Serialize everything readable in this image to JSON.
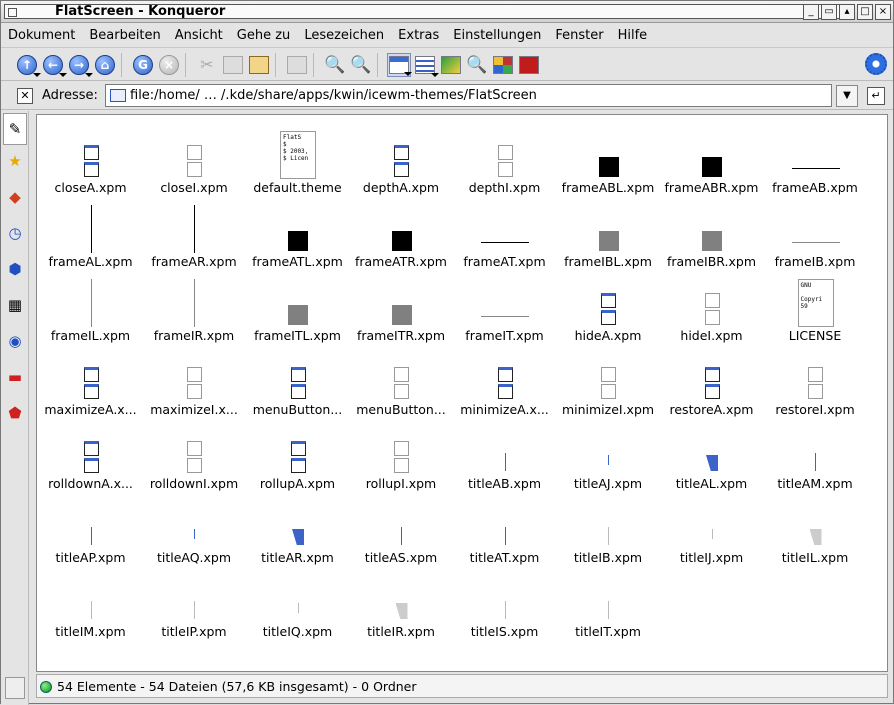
{
  "window": {
    "title": "FlatScreen - Konqueror"
  },
  "menu": [
    "Dokument",
    "Bearbeiten",
    "Ansicht",
    "Gehe zu",
    "Lesezeichen",
    "Extras",
    "Einstellungen",
    "Fenster",
    "Hilfe"
  ],
  "toolbar": {
    "icons": [
      "up-arrow-icon",
      "back-arrow-icon",
      "forward-arrow-icon",
      "home-icon",
      "reload-icon",
      "stop-icon",
      "cut-icon",
      "copy-icon",
      "paste-icon",
      "print-icon",
      "zoom-in-icon",
      "zoom-out-icon",
      "icon-view-icon",
      "detail-view-icon",
      "image-viewer-icon",
      "find-icon",
      "color-grid-icon",
      "red-grid-icon",
      "settings-gear-icon"
    ]
  },
  "address": {
    "label": "Adresse:",
    "value": "file:/home/ … /.kde/share/apps/kwin/icewm-themes/FlatScreen"
  },
  "sidebar": {
    "tabs": [
      "wizard-icon",
      "bookmark-star-icon",
      "services-icon",
      "history-icon",
      "network-icon",
      "devices-icon",
      "web-icon",
      "home-folder-icon",
      "bookmarks-red-icon"
    ]
  },
  "files": [
    {
      "name": "closeA.xpm",
      "kind": "win-blue"
    },
    {
      "name": "closeI.xpm",
      "kind": "win-gray"
    },
    {
      "name": "default.theme",
      "kind": "doc",
      "text": "FlatS\n$\n$ 2003,\n$ Licen"
    },
    {
      "name": "depthA.xpm",
      "kind": "win-blue"
    },
    {
      "name": "depthI.xpm",
      "kind": "win-gray"
    },
    {
      "name": "frameABL.xpm",
      "kind": "black"
    },
    {
      "name": "frameABR.xpm",
      "kind": "black"
    },
    {
      "name": "frameAB.xpm",
      "kind": "hline"
    },
    {
      "name": "frameAL.xpm",
      "kind": "vline"
    },
    {
      "name": "frameAR.xpm",
      "kind": "vline"
    },
    {
      "name": "frameATL.xpm",
      "kind": "black"
    },
    {
      "name": "frameATR.xpm",
      "kind": "black"
    },
    {
      "name": "frameAT.xpm",
      "kind": "hline"
    },
    {
      "name": "frameIBL.xpm",
      "kind": "gray"
    },
    {
      "name": "frameIBR.xpm",
      "kind": "gray"
    },
    {
      "name": "frameIB.xpm",
      "kind": "hline-g"
    },
    {
      "name": "frameIL.xpm",
      "kind": "vline-g"
    },
    {
      "name": "frameIR.xpm",
      "kind": "vline-g"
    },
    {
      "name": "frameITL.xpm",
      "kind": "gray"
    },
    {
      "name": "frameITR.xpm",
      "kind": "gray"
    },
    {
      "name": "frameIT.xpm",
      "kind": "hline-g"
    },
    {
      "name": "hideA.xpm",
      "kind": "win-blue"
    },
    {
      "name": "hideI.xpm",
      "kind": "win-gray"
    },
    {
      "name": "LICENSE",
      "kind": "doc",
      "text": "GNU\n\nCopyri\n59"
    },
    {
      "name": "maximizeA.x...",
      "kind": "win-blue"
    },
    {
      "name": "maximizeI.x...",
      "kind": "win-gray"
    },
    {
      "name": "menuButton...",
      "kind": "win-blue"
    },
    {
      "name": "menuButton...",
      "kind": "win-gray"
    },
    {
      "name": "minimizeA.x...",
      "kind": "win-blue"
    },
    {
      "name": "minimizeI.xpm",
      "kind": "win-gray"
    },
    {
      "name": "restoreA.xpm",
      "kind": "win-blue"
    },
    {
      "name": "restoreI.xpm",
      "kind": "win-gray"
    },
    {
      "name": "rolldownA.x...",
      "kind": "win-blue"
    },
    {
      "name": "rolldownI.xpm",
      "kind": "win-gray"
    },
    {
      "name": "rollupA.xpm",
      "kind": "win-blue"
    },
    {
      "name": "rollupI.xpm",
      "kind": "win-gray"
    },
    {
      "name": "titleAB.xpm",
      "kind": "tiny"
    },
    {
      "name": "titleAJ.xpm",
      "kind": "tiny-short"
    },
    {
      "name": "titleAL.xpm",
      "kind": "corner"
    },
    {
      "name": "titleAM.xpm",
      "kind": "tiny"
    },
    {
      "name": "titleAP.xpm",
      "kind": "tiny"
    },
    {
      "name": "titleAQ.xpm",
      "kind": "tiny-short"
    },
    {
      "name": "titleAR.xpm",
      "kind": "corner"
    },
    {
      "name": "titleAS.xpm",
      "kind": "tiny"
    },
    {
      "name": "titleAT.xpm",
      "kind": "tiny"
    },
    {
      "name": "titleIB.xpm",
      "kind": "tiny-g"
    },
    {
      "name": "titleIJ.xpm",
      "kind": "tiny-g-short"
    },
    {
      "name": "titleIL.xpm",
      "kind": "corner-g"
    },
    {
      "name": "titleIM.xpm",
      "kind": "tiny-g"
    },
    {
      "name": "titleIP.xpm",
      "kind": "tiny-g"
    },
    {
      "name": "titleIQ.xpm",
      "kind": "tiny-g-short"
    },
    {
      "name": "titleIR.xpm",
      "kind": "corner-g"
    },
    {
      "name": "titleIS.xpm",
      "kind": "tiny-g"
    },
    {
      "name": "titleIT.xpm",
      "kind": "tiny-g"
    }
  ],
  "status": {
    "text": "54 Elemente - 54 Dateien (57,6 KB insgesamt) - 0 Ordner"
  }
}
